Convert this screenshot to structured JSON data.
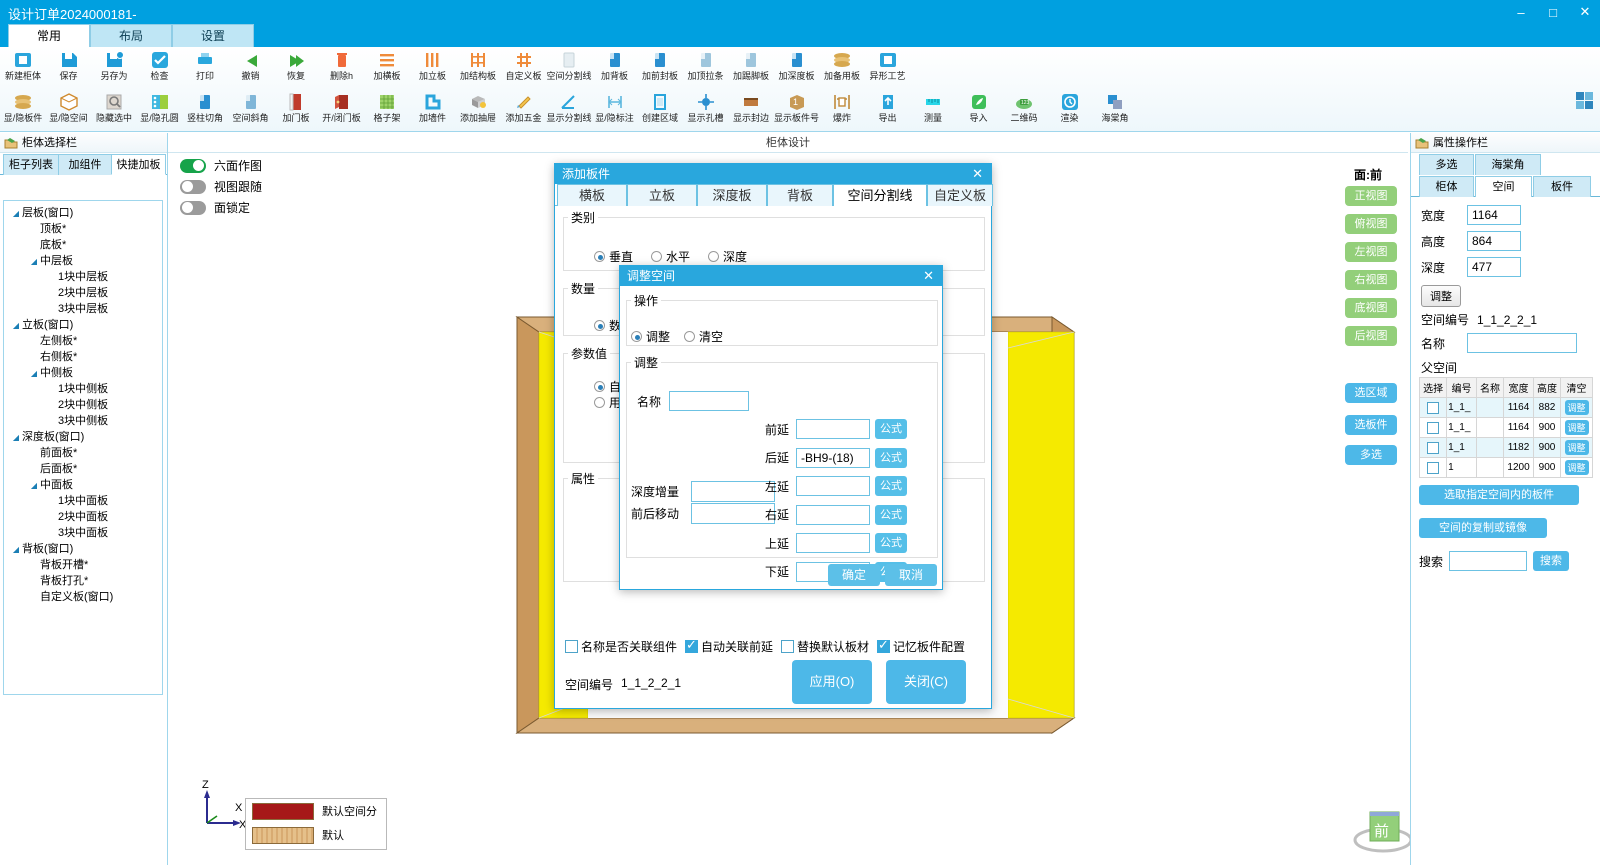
{
  "window": {
    "title": "设计订单2024000181-",
    "minimize": "–",
    "maximize": "□",
    "close": "✕"
  },
  "ribbon": {
    "tabs": [
      {
        "label": "常用",
        "active": true
      },
      {
        "label": "布局",
        "active": false
      },
      {
        "label": "设置",
        "active": false
      }
    ],
    "row1": [
      {
        "label": "新建柜体",
        "icon": "new-cabinet-icon"
      },
      {
        "label": "保存",
        "icon": "save-icon"
      },
      {
        "label": "另存为",
        "icon": "save-as-icon"
      },
      {
        "label": "检查",
        "icon": "check-icon"
      },
      {
        "label": "打印",
        "icon": "print-icon"
      },
      {
        "label": "撤销",
        "icon": "undo-icon"
      },
      {
        "label": "恢复",
        "icon": "redo-icon"
      },
      {
        "label": "删除h",
        "icon": "delete-icon"
      },
      {
        "label": "加横板",
        "icon": "add-horizontal-panel-icon"
      },
      {
        "label": "加立板",
        "icon": "add-vertical-panel-icon"
      },
      {
        "label": "加结构板",
        "icon": "add-structure-panel-icon"
      },
      {
        "label": "自定义板",
        "icon": "custom-panel-icon"
      },
      {
        "label": "空间分割线",
        "icon": "space-divider-icon"
      },
      {
        "label": "加背板",
        "icon": "add-back-panel-icon"
      },
      {
        "label": "加前封板",
        "icon": "add-front-seal-panel-icon"
      },
      {
        "label": "加顶拉条",
        "icon": "add-top-rail-icon"
      },
      {
        "label": "加踢脚板",
        "icon": "add-kickboard-icon"
      },
      {
        "label": "加深度板",
        "icon": "add-depth-panel-icon"
      },
      {
        "label": "加备用板",
        "icon": "add-spare-panel-icon"
      },
      {
        "label": "异形工艺",
        "icon": "shaped-craft-icon"
      }
    ],
    "row2": [
      {
        "label": "显/隐板件",
        "icon": "toggle-panels-icon"
      },
      {
        "label": "显/隐空间",
        "icon": "toggle-space-icon"
      },
      {
        "label": "隐藏选中",
        "icon": "hide-selected-icon"
      },
      {
        "label": "显/隐孔圆",
        "icon": "toggle-holes-icon"
      },
      {
        "label": "竖柱切角",
        "icon": "column-chamfer-icon"
      },
      {
        "label": "空间斜角",
        "icon": "space-bevel-icon"
      },
      {
        "label": "加门板",
        "icon": "add-door-icon"
      },
      {
        "label": "开/闭门板",
        "icon": "open-close-door-icon"
      },
      {
        "label": "格子架",
        "icon": "grid-rack-icon"
      },
      {
        "label": "加墙件",
        "icon": "add-wall-part-icon"
      },
      {
        "label": "添加抽屉",
        "icon": "add-drawer-icon"
      },
      {
        "label": "添加五金",
        "icon": "add-hardware-icon"
      },
      {
        "label": "显示分割线",
        "icon": "show-divider-icon"
      },
      {
        "label": "显/隐标注",
        "icon": "toggle-dimension-icon"
      },
      {
        "label": "创建区域",
        "icon": "create-area-icon"
      },
      {
        "label": "显示孔槽",
        "icon": "show-slot-icon"
      },
      {
        "label": "显示封边",
        "icon": "show-edge-banding-icon"
      },
      {
        "label": "显示板件号",
        "icon": "show-panel-number-icon"
      },
      {
        "label": "爆炸",
        "icon": "explode-icon"
      },
      {
        "label": "导出",
        "icon": "export-icon"
      },
      {
        "label": "测量",
        "icon": "measure-icon"
      },
      {
        "label": "导入",
        "icon": "import-icon"
      },
      {
        "label": "二维码",
        "icon": "qr-code-icon"
      },
      {
        "label": "渲染",
        "icon": "render-icon"
      },
      {
        "label": "海棠角",
        "icon": "haitang-corner-icon"
      }
    ],
    "grid_button": "grid-view-icon"
  },
  "left_panel": {
    "header": "柜体选择栏",
    "header_icon": "panel-icon",
    "tabs": [
      {
        "label": "柜子列表",
        "active": false
      },
      {
        "label": "加组件",
        "active": false
      },
      {
        "label": "快捷加板",
        "active": true
      }
    ],
    "tree": [
      {
        "label": "层板(窗口)",
        "depth": 0,
        "arrow": true
      },
      {
        "label": "顶板*",
        "depth": 1,
        "arrow": false
      },
      {
        "label": "底板*",
        "depth": 1,
        "arrow": false
      },
      {
        "label": "中层板",
        "depth": 1,
        "arrow": true
      },
      {
        "label": "1块中层板",
        "depth": 2,
        "arrow": false
      },
      {
        "label": "2块中层板",
        "depth": 2,
        "arrow": false
      },
      {
        "label": "3块中层板",
        "depth": 2,
        "arrow": false
      },
      {
        "label": "立板(窗口)",
        "depth": 0,
        "arrow": true
      },
      {
        "label": "左侧板*",
        "depth": 1,
        "arrow": false
      },
      {
        "label": "右侧板*",
        "depth": 1,
        "arrow": false
      },
      {
        "label": "中侧板",
        "depth": 1,
        "arrow": true
      },
      {
        "label": "1块中侧板",
        "depth": 2,
        "arrow": false
      },
      {
        "label": "2块中侧板",
        "depth": 2,
        "arrow": false
      },
      {
        "label": "3块中侧板",
        "depth": 2,
        "arrow": false
      },
      {
        "label": "深度板(窗口)",
        "depth": 0,
        "arrow": true
      },
      {
        "label": "前面板*",
        "depth": 1,
        "arrow": false
      },
      {
        "label": "后面板*",
        "depth": 1,
        "arrow": false
      },
      {
        "label": "中面板",
        "depth": 1,
        "arrow": true
      },
      {
        "label": "1块中面板",
        "depth": 2,
        "arrow": false
      },
      {
        "label": "2块中面板",
        "depth": 2,
        "arrow": false
      },
      {
        "label": "3块中面板",
        "depth": 2,
        "arrow": false
      },
      {
        "label": "背板(窗口)",
        "depth": 0,
        "arrow": true
      },
      {
        "label": "背板开槽*",
        "depth": 1,
        "arrow": false
      },
      {
        "label": "背板打孔*",
        "depth": 1,
        "arrow": false
      },
      {
        "label": "自定义板(窗口)",
        "depth": 1,
        "arrow": false
      }
    ]
  },
  "canvas": {
    "title": "柜体设计",
    "toggles": [
      {
        "label": "六面作图",
        "on": true
      },
      {
        "label": "视图跟随",
        "on": false
      },
      {
        "label": "面锁定",
        "on": false
      }
    ],
    "face_label": "面:前",
    "view_buttons": [
      {
        "label": "正视图",
        "color": "green"
      },
      {
        "label": "俯视图",
        "color": "green"
      },
      {
        "label": "左视图",
        "color": "green"
      },
      {
        "label": "右视图",
        "color": "green"
      },
      {
        "label": "底视图",
        "color": "green"
      },
      {
        "label": "后视图",
        "color": "green"
      },
      {
        "label": "选区域",
        "color": "blue"
      },
      {
        "label": "选板件",
        "color": "blue"
      },
      {
        "label": "多选",
        "color": "blue"
      }
    ],
    "legend": [
      {
        "label": "默认空间分",
        "color": "#a61818"
      },
      {
        "label": "默认",
        "color": "#e5c08a"
      }
    ],
    "axis": {
      "z": "Z",
      "x_top": "X",
      "x_right": "X"
    },
    "view_cube": "前"
  },
  "add_panel_dialog": {
    "title": "添加板件",
    "close": "✕",
    "tabs": [
      {
        "label": "横板",
        "active": false
      },
      {
        "label": "立板",
        "active": false
      },
      {
        "label": "深度板",
        "active": false
      },
      {
        "label": "背板",
        "active": false
      },
      {
        "label": "空间分割线",
        "active": true
      },
      {
        "label": "自定义板",
        "active": false
      }
    ],
    "category_group": "类别",
    "category_options": [
      {
        "label": "垂直",
        "selected": true
      },
      {
        "label": "水平",
        "selected": false
      },
      {
        "label": "深度",
        "selected": false
      }
    ],
    "count_group": "数量",
    "count_option": {
      "label": "数量",
      "selected": true
    },
    "param_group": "参数值",
    "param_options": [
      {
        "label": "自动",
        "selected": true
      },
      {
        "label": "用户",
        "selected": false
      }
    ],
    "attr_group": "属性",
    "checkboxes": [
      {
        "label": "名称是否关联组件",
        "checked": false
      },
      {
        "label": "自动关联前延",
        "checked": true
      },
      {
        "label": "替换默认板材",
        "checked": false
      },
      {
        "label": "记忆板件配置",
        "checked": true
      }
    ],
    "space_no_label": "空间编号",
    "space_no_value": "1_1_2_2_1",
    "apply_button": "应用(O)",
    "close_button": "关闭(C)"
  },
  "adjust_space_dialog": {
    "title": "调整空间",
    "close": "✕",
    "op_group": "操作",
    "op_options": [
      {
        "label": "调整",
        "selected": true
      },
      {
        "label": "清空",
        "selected": false
      }
    ],
    "adjust_group": "调整",
    "name_label": "名称",
    "name_value": "",
    "depth_increment_label": "深度增量",
    "depth_increment_value": "",
    "move_fb_label": "前后移动",
    "move_fb_value": "",
    "formula_button": "公式",
    "extensions": [
      {
        "label": "前延",
        "value": ""
      },
      {
        "label": "后延",
        "value": "-BH9-(18)"
      },
      {
        "label": "左延",
        "value": ""
      },
      {
        "label": "右延",
        "value": ""
      },
      {
        "label": "上延",
        "value": ""
      },
      {
        "label": "下延",
        "value": ""
      }
    ],
    "ok_button": "确定",
    "cancel_button": "取消"
  },
  "right_panel": {
    "header": "属性操作栏",
    "header_icon": "panel-icon",
    "tabs_row1": [
      {
        "label": "多选",
        "active": false
      },
      {
        "label": "海棠角",
        "active": false
      }
    ],
    "tabs_row2": [
      {
        "label": "柜体",
        "active": false
      },
      {
        "label": "空间",
        "active": true
      },
      {
        "label": "板件",
        "active": false
      }
    ],
    "fields": [
      {
        "label": "宽度",
        "value": "1164"
      },
      {
        "label": "高度",
        "value": "864"
      },
      {
        "label": "深度",
        "value": "477"
      }
    ],
    "adjust_button": "调整",
    "space_no_label": "空间编号",
    "space_no_value": "1_1_2_2_1",
    "name_label": "名称",
    "name_value": "",
    "parent_space_label": "父空间",
    "table_headers": [
      "选择",
      "编号",
      "名称",
      "宽度",
      "高度",
      "清空"
    ],
    "table_rows": [
      {
        "no": "1_1_",
        "name": "",
        "width": "1164",
        "height": "882",
        "action": "调整"
      },
      {
        "no": "1_1_",
        "name": "",
        "width": "1164",
        "height": "900",
        "action": "调整"
      },
      {
        "no": "1_1",
        "name": "",
        "width": "1182",
        "height": "900",
        "action": "调整"
      },
      {
        "no": "1",
        "name": "",
        "width": "1200",
        "height": "900",
        "action": "调整"
      }
    ],
    "select_panels_button": "选取指定空间内的板件",
    "copy_mirror_button": "空间的复制或镜像",
    "search_label": "搜索",
    "search_value": "",
    "search_button": "搜索"
  },
  "colors": {
    "accent": "#00a0e0",
    "dialog_header": "#29a7dd",
    "green_button": "#93cf7a",
    "blue_button": "#4db8e8"
  }
}
